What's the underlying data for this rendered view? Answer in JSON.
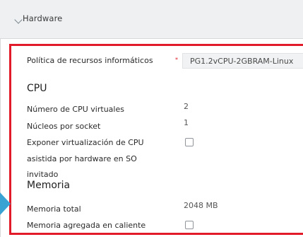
{
  "section_header": {
    "title": "Hardware"
  },
  "policy": {
    "label": "Política de recursos informáticos",
    "required_marker": "*",
    "value": "PG1.2vCPU-2GBRAM-Linux"
  },
  "cpu": {
    "heading": "CPU",
    "vcpu_label": "Número de CPU virtuales",
    "vcpu_value": "2",
    "cores_label": "Núcleos por socket",
    "cores_value": "1",
    "hwvirt_label_line1": "Exponer virtualización de CPU",
    "hwvirt_label_line2": "asistida por hardware en SO",
    "hwvirt_label_line3": "invitado",
    "hwvirt_checked": false
  },
  "memory": {
    "heading": "Memoria",
    "total_label": "Memoria total",
    "total_value": "2048 MB",
    "hotadd_label": "Memoria agregada en caliente",
    "hotadd_checked": false
  },
  "colors": {
    "highlight_border": "#e21b2a",
    "pointer_arrow": "#3aa3d4",
    "header_bg": "#eef0f2"
  }
}
